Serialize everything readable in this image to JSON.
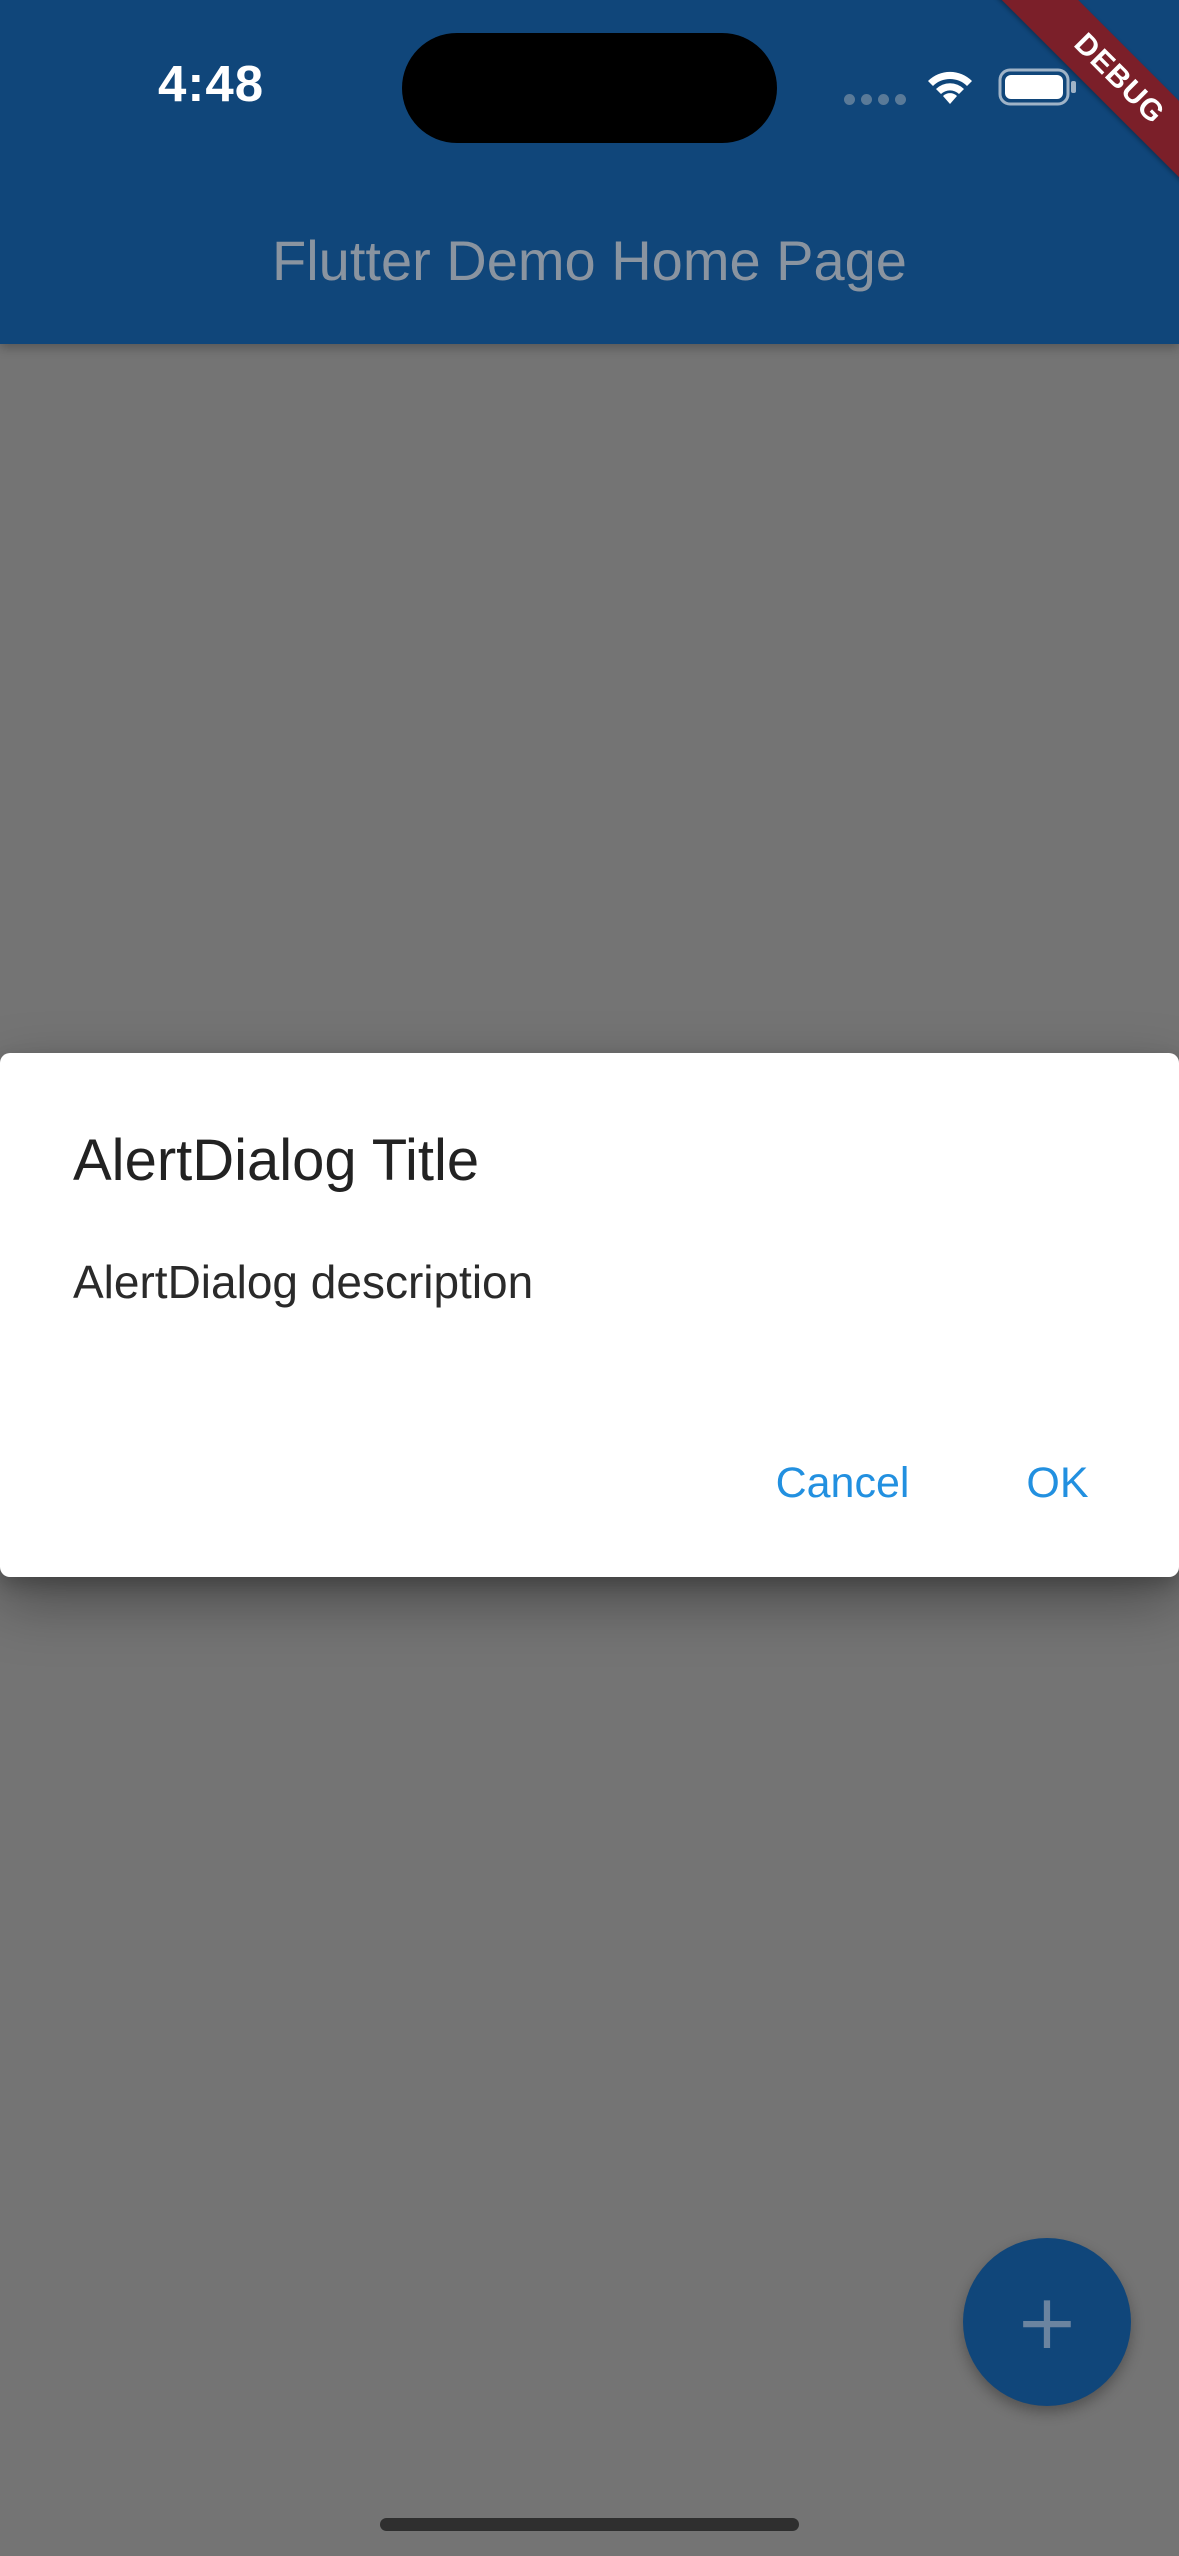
{
  "status_bar": {
    "time": "4:48",
    "signal_icon": "cellular-dots-icon",
    "wifi_icon": "wifi-icon",
    "battery_icon": "battery-icon"
  },
  "app_bar": {
    "title": "Flutter Demo Home Page",
    "color": "#10467A"
  },
  "debug_banner": {
    "label": "DEBUG",
    "color": "#7B1F29"
  },
  "dialog": {
    "title": "AlertDialog Title",
    "content": "AlertDialog description",
    "actions": {
      "cancel_label": "Cancel",
      "ok_label": "OK"
    },
    "action_color": "#2290E0"
  },
  "fab": {
    "icon": "plus-icon",
    "glyph": "+"
  },
  "barrier_color": "#747474"
}
